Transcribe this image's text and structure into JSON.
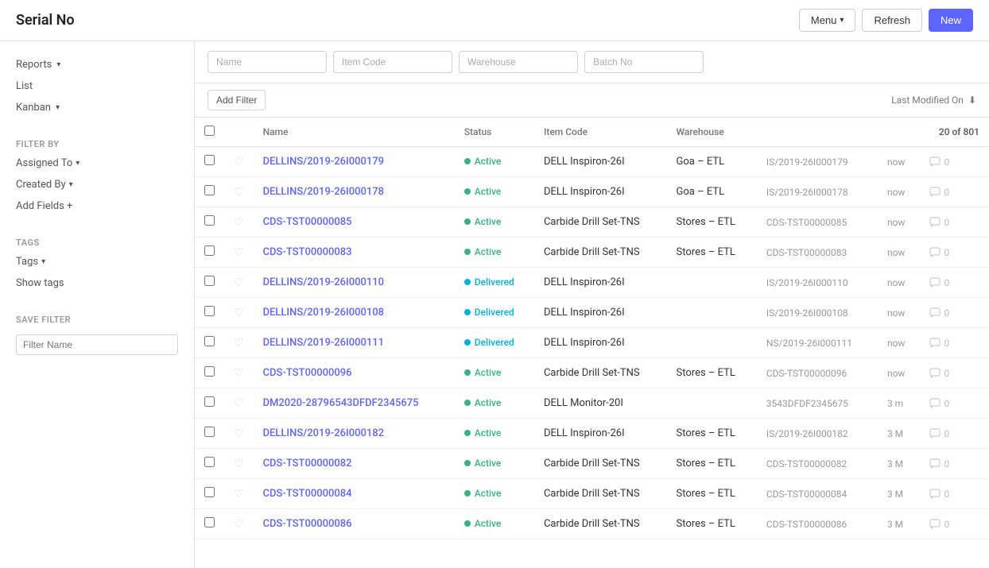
{
  "header": {
    "title": "Serial No",
    "menu_label": "Menu",
    "refresh_label": "Refresh",
    "new_label": "New"
  },
  "sidebar": {
    "reports_label": "Reports",
    "list_label": "List",
    "kanban_label": "Kanban",
    "filter_by_label": "FILTER BY",
    "assigned_to_label": "Assigned To",
    "created_by_label": "Created By",
    "add_fields_label": "Add Fields +",
    "tags_label": "TAGS",
    "tags_btn_label": "Tags",
    "show_tags_label": "Show tags",
    "save_filter_label": "SAVE FILTER",
    "filter_name_placeholder": "Filter Name"
  },
  "filters": {
    "name_placeholder": "Name",
    "item_code_placeholder": "Item Code",
    "warehouse_placeholder": "Warehouse",
    "batch_no_placeholder": "Batch No",
    "add_filter_label": "Add Filter",
    "last_modified_label": "Last Modified On"
  },
  "table": {
    "columns": [
      "Name",
      "Status",
      "Item Code",
      "Warehouse"
    ],
    "count_label": "20 of 801",
    "rows": [
      {
        "name": "DELLINS/2019-26I000179",
        "status": "Active",
        "status_type": "active",
        "item_code": "DELL Inspiron-26I",
        "warehouse": "Goa – ETL",
        "serial": "IS/2019-26I000179",
        "time": "now",
        "comments": "0"
      },
      {
        "name": "DELLINS/2019-26I000178",
        "status": "Active",
        "status_type": "active",
        "item_code": "DELL Inspiron-26I",
        "warehouse": "Goa – ETL",
        "serial": "IS/2019-26I000178",
        "time": "now",
        "comments": "0"
      },
      {
        "name": "CDS-TST00000085",
        "status": "Active",
        "status_type": "active",
        "item_code": "Carbide Drill Set-TNS",
        "warehouse": "Stores – ETL",
        "serial": "CDS-TST00000085",
        "time": "now",
        "comments": "0"
      },
      {
        "name": "CDS-TST00000083",
        "status": "Active",
        "status_type": "active",
        "item_code": "Carbide Drill Set-TNS",
        "warehouse": "Stores – ETL",
        "serial": "CDS-TST00000083",
        "time": "now",
        "comments": "0"
      },
      {
        "name": "DELLINS/2019-26I000110",
        "status": "Delivered",
        "status_type": "delivered",
        "item_code": "DELL Inspiron-26I",
        "warehouse": "",
        "serial": "IS/2019-26I000110",
        "time": "now",
        "comments": "0"
      },
      {
        "name": "DELLINS/2019-26I000108",
        "status": "Delivered",
        "status_type": "delivered",
        "item_code": "DELL Inspiron-26I",
        "warehouse": "",
        "serial": "IS/2019-26I000108",
        "time": "now",
        "comments": "0"
      },
      {
        "name": "DELLINS/2019-26I000111",
        "status": "Delivered",
        "status_type": "delivered",
        "item_code": "DELL Inspiron-26I",
        "warehouse": "",
        "serial": "NS/2019-26I000111",
        "time": "now",
        "comments": "0"
      },
      {
        "name": "CDS-TST00000096",
        "status": "Active",
        "status_type": "active",
        "item_code": "Carbide Drill Set-TNS",
        "warehouse": "Stores – ETL",
        "serial": "CDS-TST00000096",
        "time": "now",
        "comments": "0"
      },
      {
        "name": "DM2020-28796543DFDF2345675",
        "status": "Active",
        "status_type": "active",
        "item_code": "DELL Monitor-20I",
        "warehouse": "",
        "serial": "3543DFDF2345675",
        "time": "3 m",
        "comments": "0"
      },
      {
        "name": "DELLINS/2019-26I000182",
        "status": "Active",
        "status_type": "active",
        "item_code": "DELL Inspiron-26I",
        "warehouse": "Stores – ETL",
        "serial": "IS/2019-26I000182",
        "time": "3 M",
        "comments": "0"
      },
      {
        "name": "CDS-TST00000082",
        "status": "Active",
        "status_type": "active",
        "item_code": "Carbide Drill Set-TNS",
        "warehouse": "Stores – ETL",
        "serial": "CDS-TST00000082",
        "time": "3 M",
        "comments": "0"
      },
      {
        "name": "CDS-TST00000084",
        "status": "Active",
        "status_type": "active",
        "item_code": "Carbide Drill Set-TNS",
        "warehouse": "Stores – ETL",
        "serial": "CDS-TST00000084",
        "time": "3 M",
        "comments": "0"
      },
      {
        "name": "CDS-TST00000086",
        "status": "Active",
        "status_type": "active",
        "item_code": "Carbide Drill Set-TNS",
        "warehouse": "Stores – ETL",
        "serial": "CDS-TST00000086",
        "time": "3 M",
        "comments": "0"
      }
    ]
  }
}
